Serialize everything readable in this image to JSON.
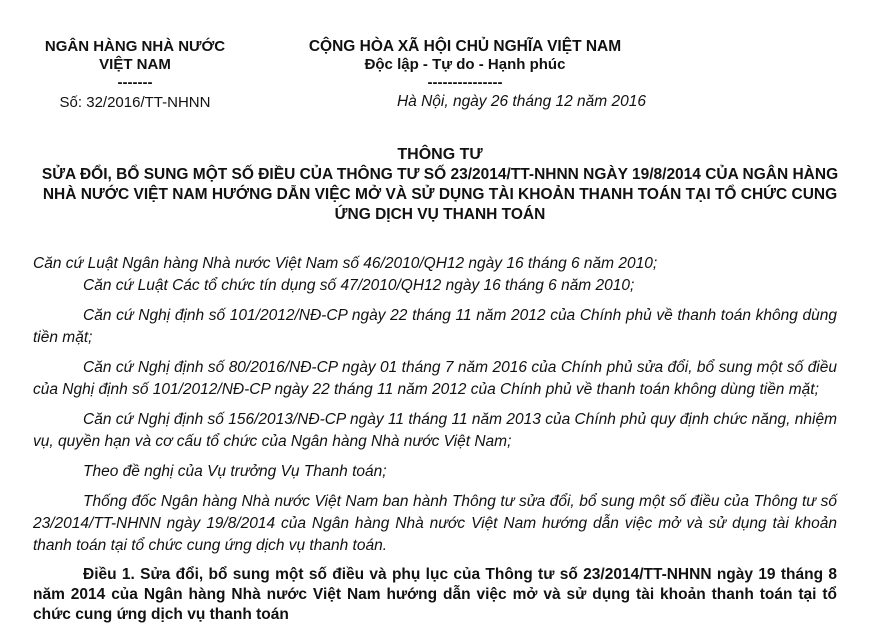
{
  "header": {
    "left": {
      "org_line1": "NGÂN HÀNG NHÀ NƯỚC",
      "org_line2": "VIỆT NAM",
      "separator": "-------",
      "number": "Số: 32/2016/TT-NHNN"
    },
    "right": {
      "nation": "CỘNG HÒA XÃ HỘI CHỦ NGHĨA VIỆT NAM",
      "motto": "Độc lập - Tự do - Hạnh phúc",
      "separator": "---------------",
      "date": "Hà Nội, ngày 26 tháng 12 năm 2016"
    }
  },
  "title": {
    "main": "THÔNG TƯ",
    "sub": "SỬA ĐỔI, BỔ SUNG MỘT SỐ ĐIỀU CỦA THÔNG TƯ SỐ 23/2014/TT-NHNN NGÀY 19/8/2014 CỦA NGÂN HÀNG NHÀ NƯỚC VIỆT NAM HƯỚNG DẪN VIỆC MỞ VÀ SỬ DỤNG TÀI KHOẢN THANH TOÁN TẠI TỔ CHỨC CUNG ỨNG DỊCH VỤ THANH TOÁN"
  },
  "preamble": [
    "Căn cứ Luật Ngân hàng Nhà nước Việt Nam số 46/2010/QH12 ngày 16 tháng 6 năm 2010;",
    "Căn cứ Luật Các tổ chức tín dụng số 47/2010/QH12 ngày 16 tháng 6 năm 2010;",
    "Căn cứ Nghị định số 101/2012/NĐ-CP ngày 22 tháng 11 năm 2012 của Chính phủ về thanh toán không dùng tiền mặt;",
    "Căn cứ Nghị định số 80/2016/NĐ-CP ngày 01 tháng 7 năm 2016 của Chính phủ sửa đổi, bổ sung một số điều của Nghị định số 101/2012/NĐ-CP ngày 22 tháng 11 năm 2012 của Chính phủ về thanh toán không dùng tiền mặt;",
    "Căn cứ Nghị định số 156/2013/NĐ-CP ngày 11 tháng 11 năm 2013 của Chính phủ quy định chức năng, nhiệm vụ, quyền hạn và cơ cấu tổ chức của Ngân hàng Nhà nước Việt Nam;",
    "Theo đề nghị của Vụ trưởng Vụ Thanh toán;",
    "Thống đốc Ngân hàng Nhà nước Việt Nam ban hành Thông tư sửa đổi, bổ sung một số điều của Thông tư số 23/2014/TT-NHNN ngày 19/8/2014 của Ngân hàng Nhà nước Việt Nam hướng dẫn việc mở và sử dụng tài khoản thanh toán tại tổ chức cung ứng dịch vụ thanh toán."
  ],
  "article1": "Điều 1. Sửa đổi, bổ sung một số điều và phụ lục của Thông tư số 23/2014/TT-NHNN ngày 19 tháng 8 năm 2014 của Ngân hàng Nhà nước Việt Nam hướng dẫn việc mở và sử dụng tài khoản thanh toán tại tổ chức cung ứng dịch vụ thanh toán"
}
